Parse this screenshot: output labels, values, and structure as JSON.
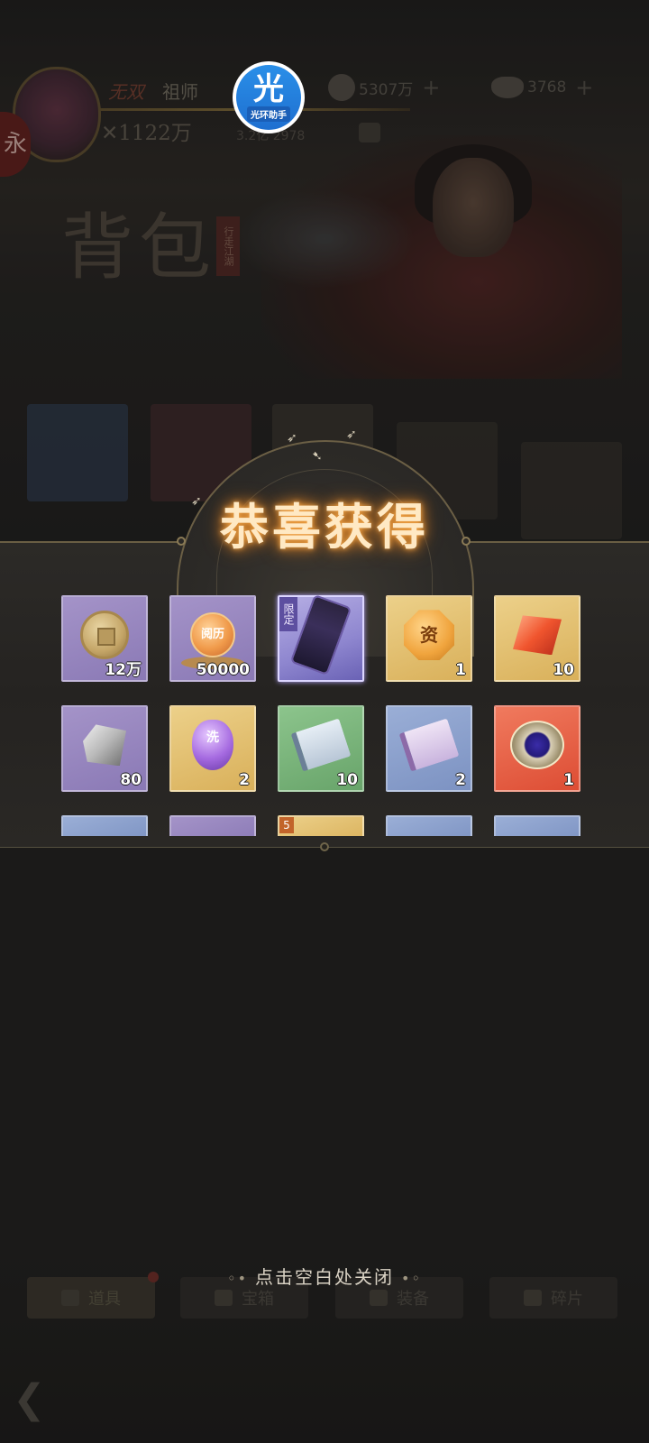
{
  "header": {
    "rank": "无双",
    "player_name": "祖师",
    "power": "✕1122万",
    "sub_value": "3.2亿 2978",
    "currencies": [
      {
        "icon": "copper-coin-icon",
        "value": "5307万",
        "plus": "+"
      },
      {
        "icon": "gold-ingot-icon",
        "value": "3768",
        "plus": "+"
      }
    ],
    "avatar_badge": "永"
  },
  "overlay_badge": {
    "glyph": "光",
    "label": "光环助手"
  },
  "background": {
    "page_title": "背包",
    "page_stamp": "行走江湖"
  },
  "reward_popup": {
    "title": "恭喜获得",
    "rows": [
      [
        {
          "icon": "copper-coin-icon",
          "rarity": "purple",
          "count": "12万"
        },
        {
          "icon": "experience-orb-icon",
          "rarity": "purple",
          "label": "阅历",
          "count": "50000"
        },
        {
          "icon": "limited-scroll-icon",
          "rarity": "limited",
          "tag": "限定",
          "count": ""
        },
        {
          "icon": "gold-seal-icon",
          "rarity": "gold",
          "label": "资",
          "count": "1"
        },
        {
          "icon": "red-gem-icon",
          "rarity": "gold",
          "count": "10"
        }
      ],
      [
        {
          "icon": "stone-icon",
          "rarity": "purple",
          "count": "80"
        },
        {
          "icon": "purple-stone-icon",
          "rarity": "gold",
          "label": "洗",
          "count": "2"
        },
        {
          "icon": "green-book-icon",
          "rarity": "green",
          "count": "10"
        },
        {
          "icon": "purple-book-icon",
          "rarity": "blue",
          "count": "2"
        },
        {
          "icon": "amulet-icon",
          "rarity": "red",
          "count": "1"
        }
      ]
    ],
    "peek_row_badge": "5"
  },
  "close_hint": "点击空白处关闭",
  "bottom_tabs": [
    {
      "label": "道具",
      "icon": "props-icon",
      "active": true
    },
    {
      "label": "宝箱",
      "icon": "chest-icon",
      "active": false
    },
    {
      "label": "装备",
      "icon": "equipment-icon",
      "active": false
    },
    {
      "label": "碎片",
      "icon": "fragment-icon",
      "active": false
    }
  ],
  "colors": {
    "title_glow": "#f6a84a",
    "panel": "#2a2825",
    "rarity_purple": "#8a79b5",
    "rarity_gold": "#d9b05a",
    "rarity_green": "#68a46a",
    "rarity_blue": "#7c92c2",
    "rarity_red": "#dd4d34"
  }
}
